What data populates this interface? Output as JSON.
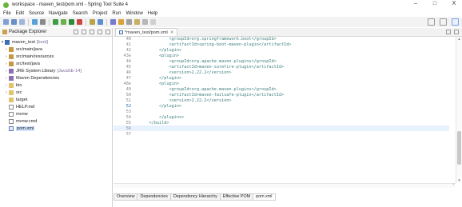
{
  "window": {
    "title": "workspace - maven_test/pom.xml - Spring Tool Suite 4",
    "controls": [
      "–",
      "□",
      "X"
    ]
  },
  "menu": [
    "File",
    "Edit",
    "Source",
    "Navigate",
    "Search",
    "Project",
    "Run",
    "Window",
    "Help"
  ],
  "package_explorer": {
    "title": "Package Explorer",
    "items": [
      {
        "arrow": "▾",
        "label": "maven_test",
        "extra": "[boot]",
        "icon": "project-icon"
      },
      {
        "arrow": "›",
        "label": "src/main/java",
        "extra": "",
        "icon": "source-folder-icon"
      },
      {
        "arrow": "›",
        "label": "src/main/resources",
        "extra": "",
        "icon": "source-folder-icon"
      },
      {
        "arrow": "›",
        "label": "src/test/java",
        "extra": "",
        "icon": "source-folder-icon"
      },
      {
        "arrow": "›",
        "label": "JRE System Library",
        "extra": "[JavaSE-14]",
        "icon": "library-icon"
      },
      {
        "arrow": "›",
        "label": "Maven Dependencies",
        "extra": "",
        "icon": "library-icon"
      },
      {
        "arrow": "›",
        "label": "bin",
        "extra": "",
        "icon": "folder-icon"
      },
      {
        "arrow": "›",
        "label": "src",
        "extra": "",
        "icon": "folder-icon"
      },
      {
        "arrow": "",
        "label": "target",
        "extra": "",
        "icon": "folder-icon"
      },
      {
        "arrow": "",
        "label": "HELP.md",
        "extra": "",
        "icon": "file-icon"
      },
      {
        "arrow": "",
        "label": "mvnw",
        "extra": "",
        "icon": "file-icon"
      },
      {
        "arrow": "",
        "label": "mvnw.cmd",
        "extra": "",
        "icon": "file-icon"
      },
      {
        "arrow": "",
        "label": "pom.xml",
        "extra": "",
        "icon": "xml-file-icon"
      }
    ]
  },
  "editor": {
    "tab_label": "*maven_test/pom.xml",
    "lines": [
      {
        "n": "40",
        "text": "            <groupId>org.springframework.boot</groupId>"
      },
      {
        "n": "41",
        "text": "            <artifactId>spring-boot-maven-plugin</artifactId>"
      },
      {
        "n": "42",
        "text": "        </plugin>"
      },
      {
        "n": "43⊖",
        "text": "        <plugin>"
      },
      {
        "n": "44",
        "text": "            <groupId>org.apache.maven.plugins</groupId>"
      },
      {
        "n": "45",
        "text": "            <artifactId>maven-surefire-plugin</artifactId>"
      },
      {
        "n": "46",
        "text": "            <version>2.22.2</version>"
      },
      {
        "n": "47",
        "text": "        </plugin>"
      },
      {
        "n": "48⊖",
        "text": "        <plugin>"
      },
      {
        "n": "49",
        "text": "            <groupId>org.apache.maven.plugins</groupId>"
      },
      {
        "n": "50",
        "text": "            <artifactId>maven-failsafe-plugin</artifactId>"
      },
      {
        "n": "51",
        "text": "            <version>2.22.2</version>"
      },
      {
        "n": "52",
        "text": "        </plugin>"
      },
      {
        "n": "53",
        "text": ""
      },
      {
        "n": "54",
        "text": "        </plugins>"
      },
      {
        "n": "55",
        "text": "    </build>"
      },
      {
        "n": "56",
        "text": ""
      },
      {
        "n": "57",
        "text": ""
      }
    ],
    "current_line": "52"
  },
  "pom_tabs": [
    "Overview",
    "Dependencies",
    "Dependency Hierarchy",
    "Effective POM",
    "pom.xml"
  ],
  "colors": {
    "accent": "#6db33f",
    "xml_tag": "#3f7f7f",
    "current_line": "#e8f2fe"
  }
}
